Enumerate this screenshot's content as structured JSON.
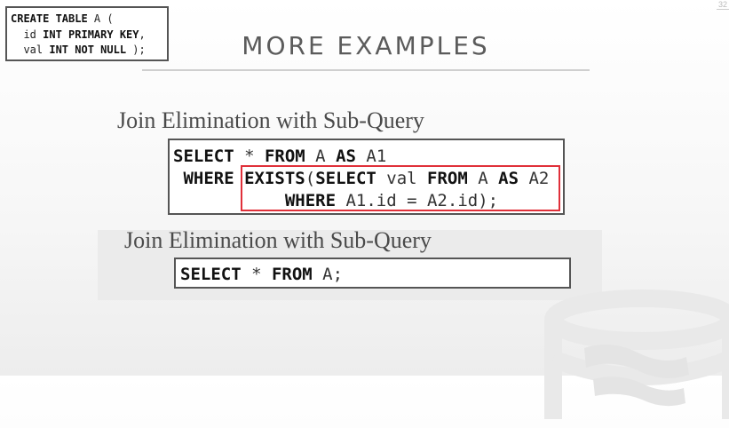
{
  "page": {
    "number": "32"
  },
  "schema": {
    "line1": {
      "kw": "CREATE TABLE",
      "rest": " A ("
    },
    "line2": {
      "pre": "  id ",
      "kw": "INT PRIMARY KEY",
      "rest": ","
    },
    "line3": {
      "pre": "  val ",
      "kw": "INT NOT NULL",
      "rest": " );"
    }
  },
  "title": "MORE EXAMPLES",
  "section1": {
    "heading": "Join Elimination with Sub-Query",
    "code": {
      "l1_kw1": "SELECT",
      "l1_t1": " * ",
      "l1_kw2": "FROM",
      "l1_t2": " A ",
      "l1_kw3": "AS",
      "l1_t3": " A1",
      "l2_kw1": "WHERE",
      "l2_t1": " ",
      "l2_kw2": "EXISTS",
      "l2_t2": "(",
      "l2_kw3": "SELECT",
      "l2_t3": " val ",
      "l2_kw4": "FROM",
      "l2_t4": " A ",
      "l2_kw5": "AS",
      "l2_t5": " A2",
      "l3_kw1": "WHERE",
      "l3_t1": " A1.id = A2.id);"
    }
  },
  "section2": {
    "heading": "Join Elimination with Sub-Query",
    "code": {
      "kw1": "SELECT",
      "t1": " * ",
      "kw2": "FROM",
      "t2": " A;"
    }
  },
  "colors": {
    "highlight": "#e0303a",
    "title": "#5b5b5b"
  },
  "icons": {
    "logo": "database-cylinder-logo"
  }
}
